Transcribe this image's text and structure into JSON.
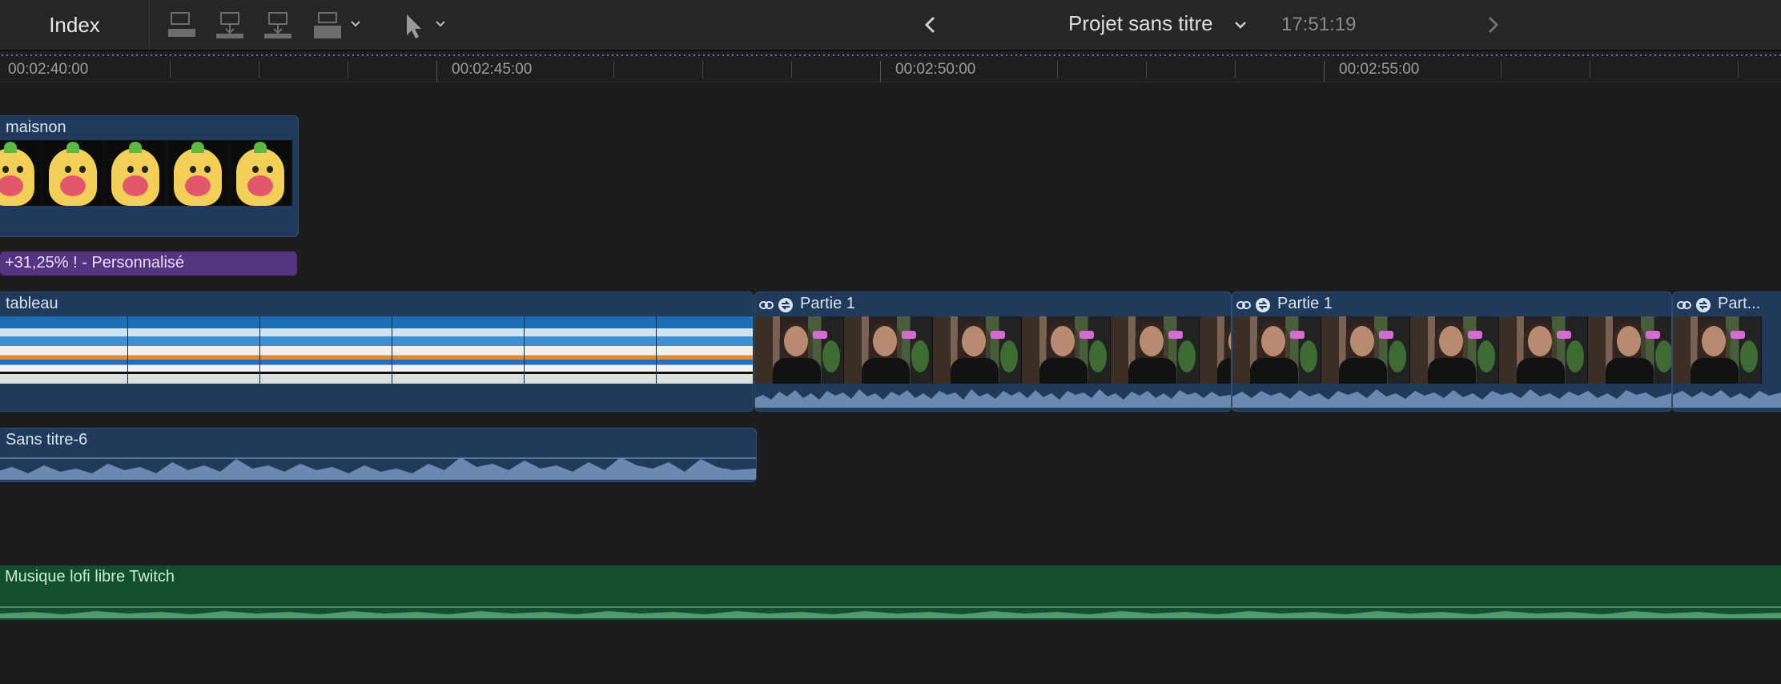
{
  "toolbar": {
    "index_label": "Index",
    "project_title": "Projet sans titre",
    "timecode": "17:51:19",
    "icons": [
      "append-clip-icon",
      "insert-clip-icon",
      "connect-clip-icon",
      "overwrite-clip-icon",
      "select-tool-icon",
      "back-icon",
      "forward-icon"
    ]
  },
  "ruler": {
    "labels": [
      "00:02:40:00",
      "00:02:45:00",
      "00:02:50:00",
      "00:02:55:00"
    ]
  },
  "clips": {
    "maisnon": "maisnon",
    "effect_bar": "+31,25% ! - Personnalisé",
    "tableau": "tableau",
    "partie_1a": "Partie 1",
    "partie_1b": "Partie 1",
    "partie_1c": "Part...",
    "sans_titre": "Sans titre-6",
    "musique": "Musique lofi libre Twitch"
  },
  "colors": {
    "video_clip": "#1f3a5a",
    "effect_bar": "#54347f",
    "audio_music": "#134f2e",
    "background": "#1d1d1e"
  }
}
